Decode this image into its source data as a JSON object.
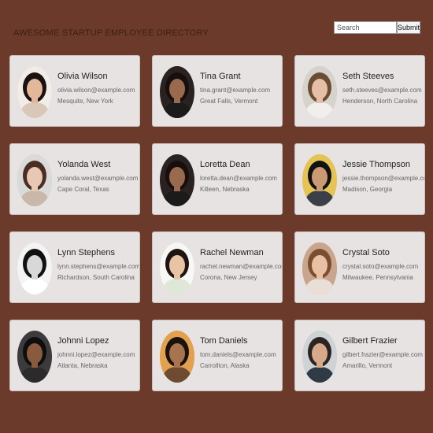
{
  "header": {
    "title": "Awesome Startup Employee Directory",
    "search_placeholder": "Search",
    "submit_label": "Submit"
  },
  "employees": [
    {
      "name": "Olivia Wilson",
      "email": "olivia.wilson@example.com",
      "location": "Mesquite, New York",
      "photo": {
        "bg": "#f2ece8",
        "hair": "#1a1210",
        "skin": "#e2b79a",
        "shirt": "#d9c7b8"
      }
    },
    {
      "name": "Tina Grant",
      "email": "tina.grant@example.com",
      "location": "Great Falls, Vermont",
      "photo": {
        "bg": "#2a2220",
        "hair": "#160f0d",
        "skin": "#9a6a4f",
        "shirt": "#1b1b1b"
      }
    },
    {
      "name": "Seth Steeves",
      "email": "seth.steeves@example.com",
      "location": "Henderson, North Carolina",
      "photo": {
        "bg": "#d6d2cc",
        "hair": "#6b4d35",
        "skin": "#e5c0a6",
        "shirt": "#f1efec"
      }
    },
    {
      "name": "Yolanda West",
      "email": "yolanda.west@example.com",
      "location": "Cape Coral, Texas",
      "photo": {
        "bg": "#dadada",
        "hair": "#4a2e22",
        "skin": "#e9c7b5",
        "shirt": "#c9b7a9"
      }
    },
    {
      "name": "Loretta Dean",
      "email": "loretta.dean@example.com",
      "location": "Killeen, Nebraska",
      "photo": {
        "bg": "#2a2220",
        "hair": "#160f0d",
        "skin": "#9a6a4f",
        "shirt": "#1b1b1b"
      }
    },
    {
      "name": "Jessie Thompson",
      "email": "jessie.thompson@example.com",
      "location": "Madison, Georgia",
      "photo": {
        "bg": "#e6c454",
        "hair": "#121212",
        "skin": "#c99a73",
        "shirt": "#3a3f48"
      }
    },
    {
      "name": "Lynn Stephens",
      "email": "lynn.stephens@example.com",
      "location": "Richardson, South Carolina",
      "photo": {
        "bg": "#f4f4f4",
        "hair": "#111111",
        "skin": "#d8d8d8",
        "shirt": "#ffffff"
      }
    },
    {
      "name": "Rachel Newman",
      "email": "rachel.newman@example.com",
      "location": "Corona, New Jersey",
      "photo": {
        "bg": "#f7f7f5",
        "hair": "#1c1512",
        "skin": "#e8c4a2",
        "shirt": "#dfe8d8"
      }
    },
    {
      "name": "Crystal Soto",
      "email": "crystal.soto@example.com",
      "location": "Milwaukee, Pennsylvania",
      "photo": {
        "bg": "#caa58e",
        "hair": "#7a4e2f",
        "skin": "#e8c1a4",
        "shirt": "#eadfd8"
      }
    },
    {
      "name": "Johnni Lopez",
      "email": "johnni.lopez@example.com",
      "location": "Atlanta, Nebraska",
      "photo": {
        "bg": "#3c3a3c",
        "hair": "#0e0e0e",
        "skin": "#8a5a3e",
        "shirt": "#2b2b2b"
      }
    },
    {
      "name": "Tom Daniels",
      "email": "tom.daniels@example.com",
      "location": "Carrollton, Alaska",
      "photo": {
        "bg": "#e2a14e",
        "hair": "#1a120e",
        "skin": "#a8734f",
        "shirt": "#6d4a30"
      }
    },
    {
      "name": "Gilbert Frazier",
      "email": "gilbert.frazier@example.com",
      "location": "Amarillo, Vermont",
      "photo": {
        "bg": "#cfd3d6",
        "hair": "#2a2522",
        "skin": "#d7a98b",
        "shirt": "#2f3a44"
      }
    }
  ]
}
